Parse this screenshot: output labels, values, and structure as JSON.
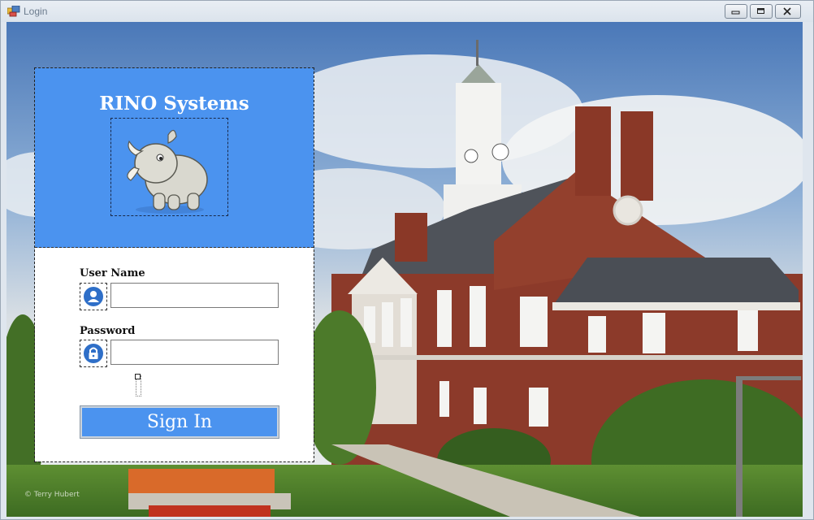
{
  "window": {
    "title": "Login",
    "minimize_icon": "minimize-icon",
    "maximize_icon": "maximize-icon",
    "close_icon": "close-icon"
  },
  "background": {
    "image": "campus-building-photo",
    "copyright": "© Terry Hubert"
  },
  "header": {
    "brand": "RINO Systems",
    "logo": "rhino-logo",
    "color": "#4b93ef"
  },
  "form": {
    "username_label": "User Name",
    "username_icon": "user-icon",
    "username_value": "",
    "password_label": "Password",
    "password_icon": "lock-icon",
    "password_value": "",
    "signin_label": "Sign In"
  }
}
